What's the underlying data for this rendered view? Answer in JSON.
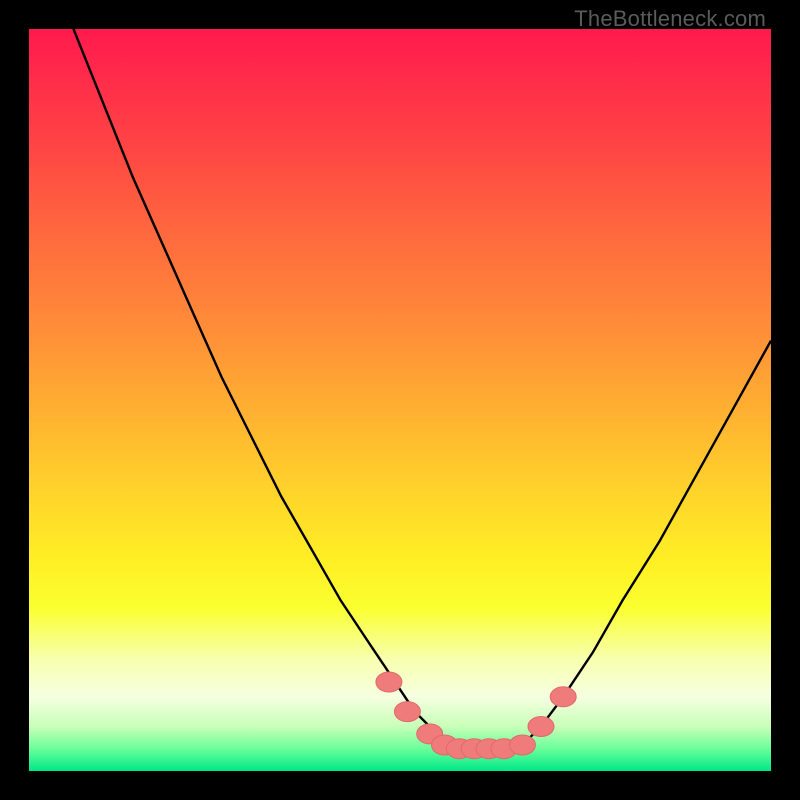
{
  "watermark": {
    "text": "TheBottleneck.com"
  },
  "colors": {
    "frame": "#000000",
    "curve": "#000000",
    "marker_fill": "#ef7b7b",
    "marker_stroke": "#e06a6a",
    "watermark": "#5b5b5b"
  },
  "chart_data": {
    "type": "line",
    "title": "",
    "xlabel": "",
    "ylabel": "",
    "xlim": [
      0,
      100
    ],
    "ylim": [
      0,
      100
    ],
    "grid": false,
    "legend": false,
    "series": [
      {
        "name": "left-curve",
        "x": [
          6,
          10,
          14,
          18,
          22,
          26,
          30,
          34,
          38,
          42,
          46,
          48,
          50,
          52,
          54,
          55,
          56
        ],
        "y": [
          100,
          90,
          80,
          71,
          62,
          53,
          45,
          37,
          30,
          23,
          17,
          14,
          11,
          8,
          6,
          5,
          4
        ]
      },
      {
        "name": "right-curve",
        "x": [
          67,
          69,
          72,
          76,
          80,
          85,
          90,
          95,
          100
        ],
        "y": [
          4,
          6,
          10,
          16,
          23,
          31,
          40,
          49,
          58
        ]
      },
      {
        "name": "flat-bottom",
        "x": [
          56,
          58,
          60,
          62,
          64,
          66,
          67
        ],
        "y": [
          4,
          3,
          3,
          3,
          3,
          3,
          4
        ]
      }
    ],
    "markers": {
      "name": "highlighted-points",
      "shape": "pill",
      "points": [
        {
          "x": 48.5,
          "y": 12
        },
        {
          "x": 51,
          "y": 8
        },
        {
          "x": 54,
          "y": 5
        },
        {
          "x": 56,
          "y": 3.5
        },
        {
          "x": 58,
          "y": 3
        },
        {
          "x": 60,
          "y": 3
        },
        {
          "x": 62,
          "y": 3
        },
        {
          "x": 64,
          "y": 3
        },
        {
          "x": 66.5,
          "y": 3.5
        },
        {
          "x": 69,
          "y": 6
        },
        {
          "x": 72,
          "y": 10
        }
      ]
    }
  }
}
